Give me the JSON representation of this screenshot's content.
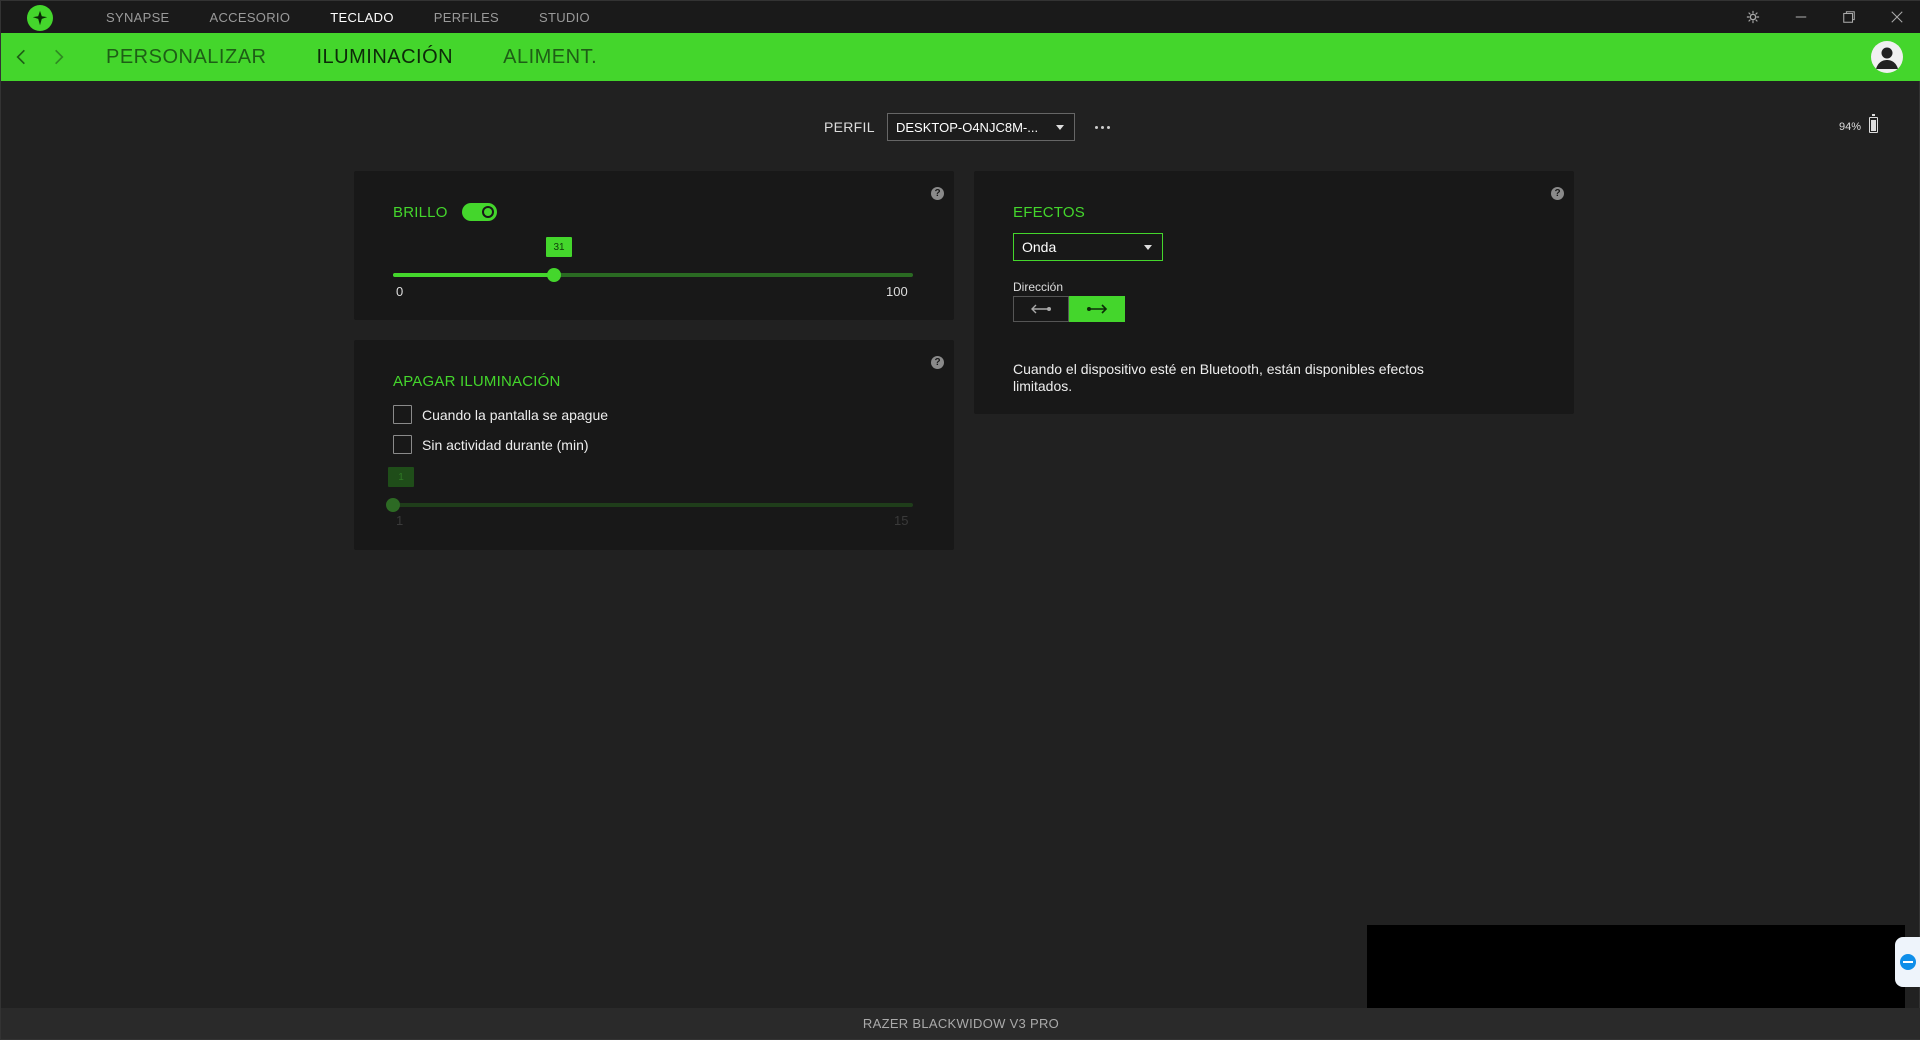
{
  "topnav": {
    "items": [
      "SYNAPSE",
      "ACCESORIO",
      "TECLADO",
      "PERFILES",
      "STUDIO"
    ],
    "active": "TECLADO"
  },
  "subtabs": {
    "items": [
      "PERSONALIZAR",
      "ILUMINACIÓN",
      "ALIMENT."
    ],
    "active": "ILUMINACIÓN"
  },
  "profile": {
    "label": "PERFIL",
    "value": "DESKTOP-O4NJC8M-..."
  },
  "battery": {
    "text": "94%",
    "level_percent": 94
  },
  "brightness": {
    "title": "BRILLO",
    "enabled": true,
    "value": "31",
    "min": "0",
    "max": "100"
  },
  "lights_off": {
    "title": "APAGAR ILUMINACIÓN",
    "option_screen_off": "Cuando la pantalla se apague",
    "option_idle": "Sin actividad durante (min)",
    "screen_off_checked": false,
    "idle_checked": false,
    "idle_value": "1",
    "idle_min": "1",
    "idle_max": "15"
  },
  "effects": {
    "title": "EFECTOS",
    "selected": "Onda",
    "direction_label": "Dirección",
    "direction_options": [
      "left",
      "right"
    ],
    "direction_active": "right",
    "info": "Cuando el dispositivo esté en Bluetooth, están disponibles efectos limitados."
  },
  "footer": {
    "device_name": "RAZER BLACKWIDOW V3 PRO"
  },
  "colors": {
    "accent": "#44d62c",
    "background": "#212121",
    "panel": "#181818"
  }
}
